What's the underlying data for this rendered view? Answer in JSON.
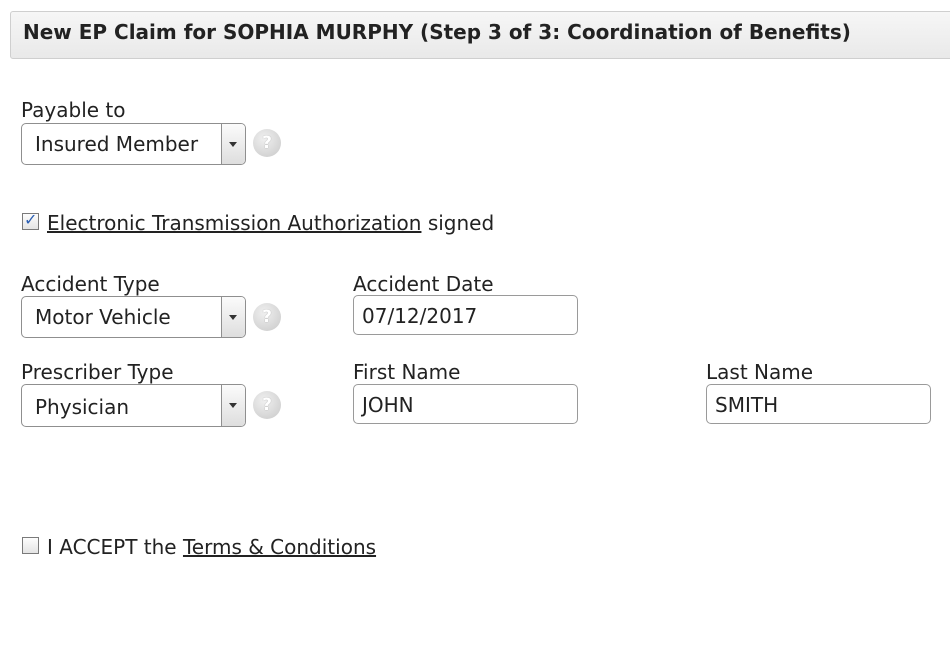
{
  "header": {
    "title": "New EP Claim for SOPHIA MURPHY (Step 3 of 3: Coordination of Benefits)"
  },
  "payable_to": {
    "label": "Payable to",
    "value": "Insured Member",
    "help": "?"
  },
  "eta": {
    "checked": true,
    "link": "Electronic Transmission Authorization",
    "suffix": "signed"
  },
  "accident_type": {
    "label": "Accident Type",
    "value": "Motor Vehicle",
    "help": "?"
  },
  "accident_date": {
    "label": "Accident Date",
    "value": "07/12/2017"
  },
  "prescriber_type": {
    "label": "Prescriber Type",
    "value": "Physician",
    "help": "?"
  },
  "first_name": {
    "label": "First Name",
    "value": "JOHN"
  },
  "last_name": {
    "label": "Last Name",
    "value": "SMITH"
  },
  "terms": {
    "checked": false,
    "prefix": "I ACCEPT the",
    "link": "Terms & Conditions"
  }
}
